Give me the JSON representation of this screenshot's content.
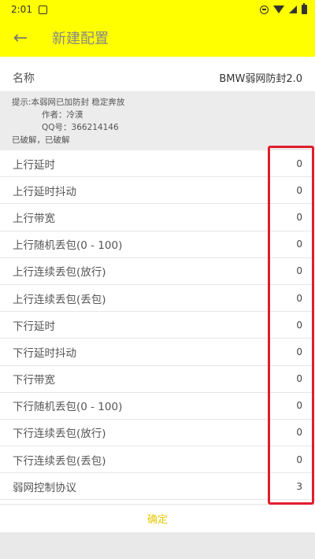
{
  "status_bar": {
    "time": "2:01"
  },
  "app_bar": {
    "title": "新建配置",
    "back_icon": "←"
  },
  "name_row": {
    "label": "名称",
    "value": "BMW弱网防封2.0"
  },
  "info": {
    "line1": "提示:本弱网已加防封 稳定奔放",
    "line2": "作者：冷漠",
    "line3": "QQ号：366214146",
    "line4": "已破解，已破解"
  },
  "settings": [
    {
      "label": "上行延时",
      "value": "0"
    },
    {
      "label": "上行延时抖动",
      "value": "0"
    },
    {
      "label": "上行带宽",
      "value": "0"
    },
    {
      "label": "上行随机丢包(0 - 100)",
      "value": "0"
    },
    {
      "label": "上行连续丢包(放行)",
      "value": "0"
    },
    {
      "label": "上行连续丢包(丢包)",
      "value": "0"
    },
    {
      "label": "下行延时",
      "value": "0"
    },
    {
      "label": "下行延时抖动",
      "value": "0"
    },
    {
      "label": "下行带宽",
      "value": "0"
    },
    {
      "label": "下行随机丢包(0 - 100)",
      "value": "0"
    },
    {
      "label": "下行连续丢包(放行)",
      "value": "0"
    },
    {
      "label": "下行连续丢包(丢包)",
      "value": "0"
    },
    {
      "label": "弱网控制协议",
      "value": "3"
    }
  ],
  "confirm_label": "确定",
  "colors": {
    "accent": "#ffff00",
    "confirm_text": "#e8c800",
    "highlight": "#e11d2c"
  }
}
